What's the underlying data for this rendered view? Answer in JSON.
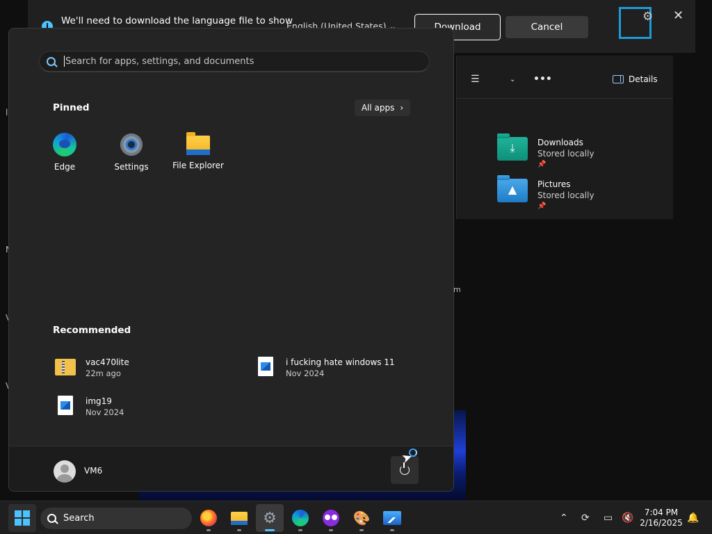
{
  "language_prompt": {
    "message": "We'll need to download the language file to show",
    "selected_language": "English (United States)",
    "download_label": "Download",
    "cancel_label": "Cancel"
  },
  "explorer": {
    "details_label": "Details",
    "quick_access": [
      {
        "name": "Downloads",
        "status": "Stored locally"
      },
      {
        "name": "Pictures",
        "status": "Stored locally"
      }
    ]
  },
  "start_menu": {
    "search_placeholder": "Search for apps, settings, and documents",
    "pinned_title": "Pinned",
    "all_apps_label": "All apps",
    "pinned": [
      {
        "label": "Edge",
        "icon": "edge-icon"
      },
      {
        "label": "Settings",
        "icon": "settings-icon"
      },
      {
        "label": "File Explorer",
        "icon": "file-explorer-icon"
      }
    ],
    "recommended_title": "Recommended",
    "recommended": [
      {
        "name": "vac470lite",
        "time": "22m ago",
        "icon": "zip-folder-icon"
      },
      {
        "name": "i fucking hate windows 11",
        "time": "Nov 2024",
        "icon": "image-file-icon"
      },
      {
        "name": "img19",
        "time": "Nov 2024",
        "icon": "image-file-icon"
      }
    ],
    "user_name": "VM6"
  },
  "taskbar": {
    "search_label": "Search",
    "time": "7:04 PM",
    "date": "2/16/2025",
    "apps": [
      "firefox-icon",
      "file-explorer-icon",
      "settings-icon",
      "edge-icon",
      "owl-app-icon",
      "paint-icon",
      "photos-icon"
    ]
  },
  "colors": {
    "accent": "#4cc2ff",
    "focus_outline": "#1d9bd8",
    "start_bg": "#242424"
  }
}
